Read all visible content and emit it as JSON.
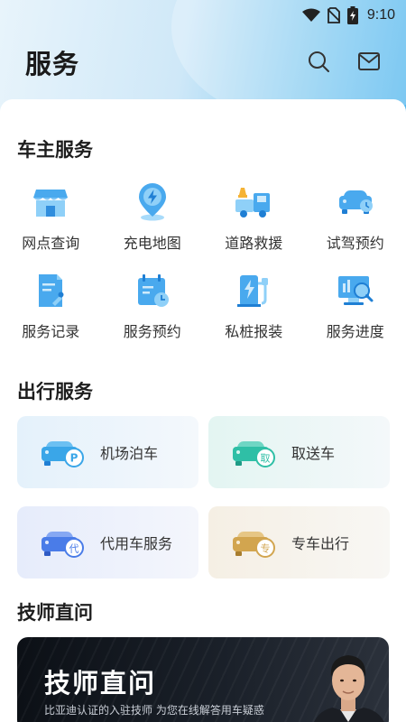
{
  "status_bar": {
    "time": "9:10",
    "icons": [
      "wifi-icon",
      "no-sim-icon",
      "battery-charging-icon"
    ]
  },
  "header": {
    "title": "服务",
    "actions": [
      {
        "icon": "search-icon"
      },
      {
        "icon": "message-icon"
      }
    ]
  },
  "owner_services": {
    "title": "车主服务",
    "items": [
      {
        "label": "网点查询",
        "icon": "store-icon"
      },
      {
        "label": "充电地图",
        "icon": "charging-map-icon"
      },
      {
        "label": "道路救援",
        "icon": "tow-truck-icon"
      },
      {
        "label": "试驾预约",
        "icon": "test-drive-icon"
      },
      {
        "label": "服务记录",
        "icon": "service-record-icon"
      },
      {
        "label": "服务预约",
        "icon": "appointment-icon"
      },
      {
        "label": "私桩报装",
        "icon": "charger-install-icon"
      },
      {
        "label": "服务进度",
        "icon": "progress-search-icon"
      }
    ]
  },
  "travel_services": {
    "title": "出行服务",
    "items": [
      {
        "label": "机场泊车",
        "icon": "parking-car-icon",
        "badge": "P",
        "color": "#3aa6e8"
      },
      {
        "label": "取送车",
        "icon": "pickup-car-icon",
        "badge": "取",
        "color": "#2fbfa6"
      },
      {
        "label": "代用车服务",
        "icon": "substitute-car-icon",
        "badge": "代",
        "color": "#4a7ce8"
      },
      {
        "label": "专车出行",
        "icon": "chauffeur-car-icon",
        "badge": "专",
        "color": "#d2a54f"
      }
    ]
  },
  "technician": {
    "title": "技师直问",
    "banner_title": "技师直问",
    "banner_subtitle": "比亚迪认证的入驻技师   为您在线解答用车疑惑"
  }
}
